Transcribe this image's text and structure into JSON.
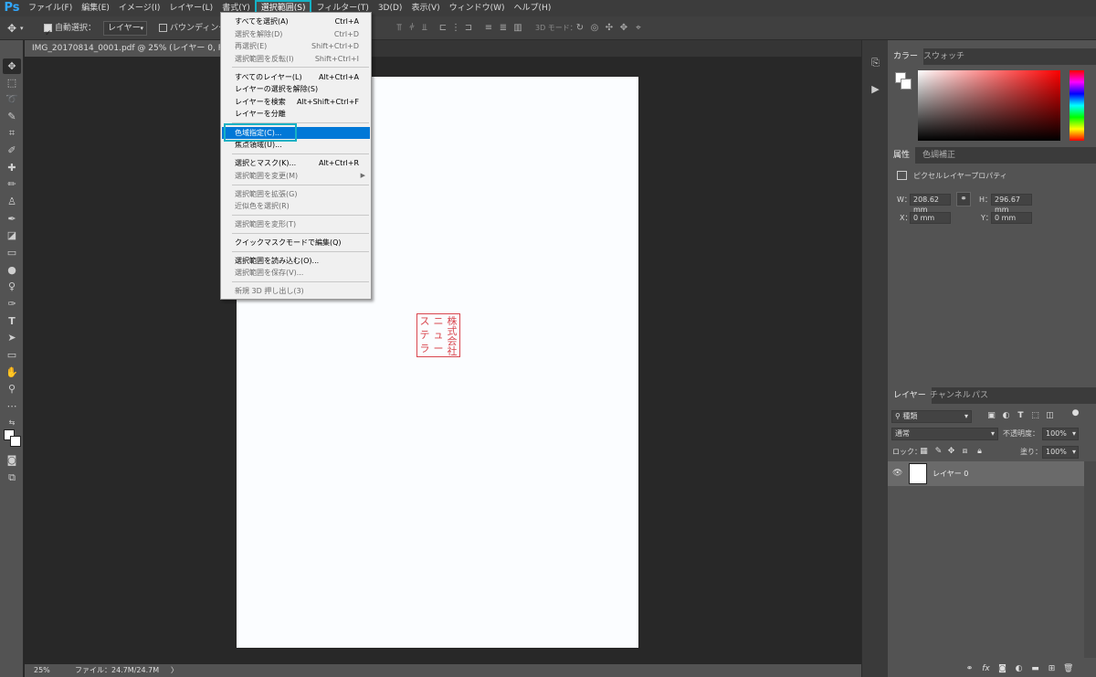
{
  "app": {
    "logo": "Ps"
  },
  "menubar": {
    "items": [
      "ファイル(F)",
      "編集(E)",
      "イメージ(I)",
      "レイヤー(L)",
      "書式(Y)",
      "選択範囲(S)",
      "フィルター(T)",
      "3D(D)",
      "表示(V)",
      "ウィンドウ(W)",
      "ヘルプ(H)"
    ],
    "active": "選択範囲(S)"
  },
  "options_bar": {
    "auto_select_label": "自動選択：",
    "auto_select_checked": true,
    "auto_select_target": "レイヤー",
    "bounding_box_label": "バウンディングボ",
    "bounding_box_checked": false,
    "mode_3d_label": "3D モード："
  },
  "document": {
    "tab_title": "IMG_20170814_0001.pdf @ 25% (レイヤー 0, RGB/8#)",
    "seal_chars": [
      "株",
      "式",
      "会",
      "社",
      "ニ",
      "ュ",
      "ー",
      "ス",
      "テ",
      "ラ"
    ]
  },
  "status": {
    "zoom": "25%",
    "file_info": "ファイル：24.7M/24.7M",
    "arrow": "〉"
  },
  "dropdown": {
    "items": [
      {
        "label": "すべてを選択(A)",
        "shortcut": "Ctrl+A",
        "disabled": false
      },
      {
        "label": "選択を解除(D)",
        "shortcut": "Ctrl+D",
        "disabled": true
      },
      {
        "label": "再選択(E)",
        "shortcut": "Shift+Ctrl+D",
        "disabled": true
      },
      {
        "label": "選択範囲を反転(I)",
        "shortcut": "Shift+Ctrl+I",
        "disabled": true
      },
      {
        "label": "すべてのレイヤー(L)",
        "shortcut": "Alt+Ctrl+A",
        "disabled": false
      },
      {
        "label": "レイヤーの選択を解除(S)",
        "shortcut": "",
        "disabled": false
      },
      {
        "label": "レイヤーを検索",
        "shortcut": "Alt+Shift+Ctrl+F",
        "disabled": false
      },
      {
        "label": "レイヤーを分離",
        "shortcut": "",
        "disabled": false
      },
      {
        "label": "色域指定(C)...",
        "shortcut": "",
        "disabled": false
      },
      {
        "label": "焦点領域(U)...",
        "shortcut": "",
        "disabled": false
      },
      {
        "label": "選択とマスク(K)...",
        "shortcut": "Alt+Ctrl+R",
        "disabled": false
      },
      {
        "label": "選択範囲を変更(M)",
        "shortcut": "",
        "disabled": true
      },
      {
        "label": "選択範囲を拡張(G)",
        "shortcut": "",
        "disabled": true
      },
      {
        "label": "近似色を選択(R)",
        "shortcut": "",
        "disabled": true
      },
      {
        "label": "選択範囲を変形(T)",
        "shortcut": "",
        "disabled": true
      },
      {
        "label": "クイックマスクモードで編集(Q)",
        "shortcut": "",
        "disabled": false
      },
      {
        "label": "選択範囲を読み込む(O)...",
        "shortcut": "",
        "disabled": false
      },
      {
        "label": "選択範囲を保存(V)...",
        "shortcut": "",
        "disabled": true
      },
      {
        "label": "新規 3D 押し出し(3)",
        "shortcut": "",
        "disabled": true
      }
    ],
    "highlighted": "色域指定(C)..."
  },
  "panels": {
    "color_tabs": [
      "カラー",
      "スウォッチ"
    ],
    "props_tabs": [
      "属性",
      "色調補正"
    ],
    "props_title": "ピクセルレイヤープロパティ",
    "w_label": "W：",
    "w_value": "208.62 mm",
    "h_label": "H：",
    "h_value": "296.67 mm",
    "x_label": "X：",
    "x_value": "0 mm",
    "y_label": "Y：",
    "y_value": "0 mm",
    "layers_tabs": [
      "レイヤー",
      "チャンネル",
      "パス"
    ],
    "kind_filter": "種類",
    "blend_mode": "通常",
    "opacity_label": "不透明度：",
    "opacity_value": "100%",
    "lock_label": "ロック：",
    "fill_label": "塗り：",
    "fill_value": "100%",
    "layer_name": "レイヤー 0"
  },
  "colors": {
    "accent_highlight": "#16b1c4",
    "menu_highlight": "#0078d7",
    "seal_red": "#d9464e"
  }
}
